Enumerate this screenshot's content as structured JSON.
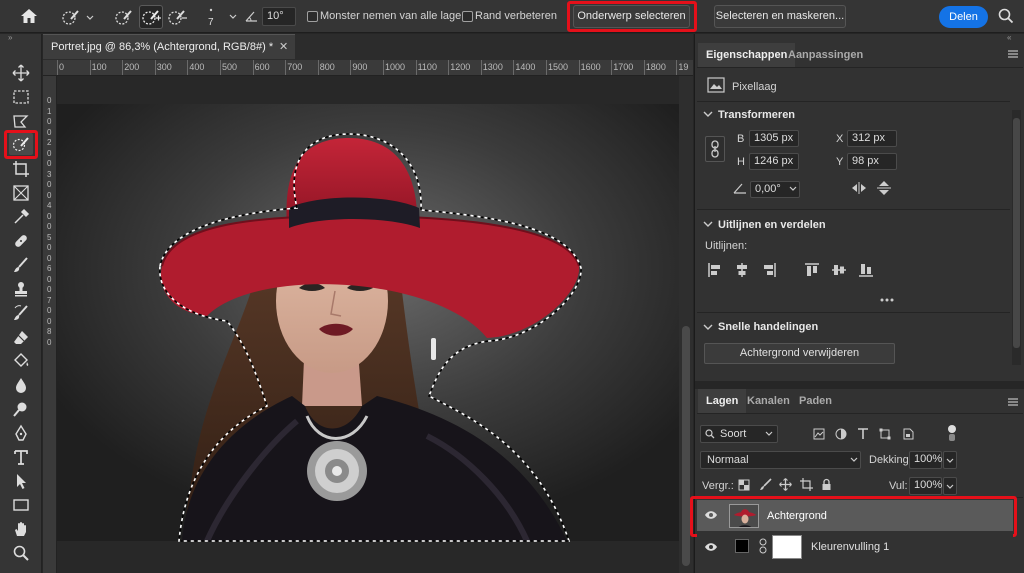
{
  "options_bar": {
    "brush_size": "7",
    "angle_value": "10°",
    "sample_all_layers_label": "Monster nemen van alle lagen",
    "enhance_edge_label": "Rand verbeteren",
    "select_subject_label": "Onderwerp selecteren",
    "select_mask_label": "Selecteren en maskeren...",
    "share_label": "Delen"
  },
  "document": {
    "tab_title": "Portret.jpg @ 86,3% (Achtergrond, RGB/8#) *",
    "ruler_ticks": [
      "0",
      "100",
      "200",
      "300",
      "400",
      "500",
      "600",
      "700",
      "800",
      "900",
      "1000",
      "1100",
      "1200",
      "1300",
      "1400",
      "1500",
      "1600",
      "1700",
      "1800",
      "19"
    ],
    "ruler_left_ticks": [
      "0",
      "1",
      "0",
      "0",
      "2",
      "0",
      "0",
      "3",
      "0",
      "0",
      "4",
      "0",
      "0",
      "5",
      "0",
      "0",
      "6",
      "0",
      "0",
      "7",
      "0",
      "0",
      "8",
      "0"
    ]
  },
  "properties": {
    "tabs": [
      "Eigenschappen",
      "Aanpassingen"
    ],
    "layer_type": "Pixellaag",
    "transform_title": "Transformeren",
    "w_label": "B",
    "w_value": "1305 px",
    "h_label": "H",
    "h_value": "1246 px",
    "x_label": "X",
    "x_value": "312 px",
    "y_label": "Y",
    "y_value": "98 px",
    "angle_value": "0,00°",
    "align_title": "Uitlijnen en verdelen",
    "align_label": "Uitlijnen:",
    "quick_actions_title": "Snelle handelingen",
    "remove_bg_label": "Achtergrond verwijderen"
  },
  "layers": {
    "tabs": [
      "Lagen",
      "Kanalen",
      "Paden"
    ],
    "filter_label": "Soort",
    "blend_mode": "Normaal",
    "opacity_label": "Dekking:",
    "opacity_value": "100%",
    "lock_label": "Vergr.:",
    "fill_label": "Vul:",
    "fill_value": "100%",
    "items": [
      {
        "name": "Achtergrond"
      },
      {
        "name": "Kleurenvulling 1"
      }
    ]
  },
  "colors": {
    "highlight": "#e5101a",
    "share_button": "#1473e6",
    "hat": "#b01c2e"
  }
}
